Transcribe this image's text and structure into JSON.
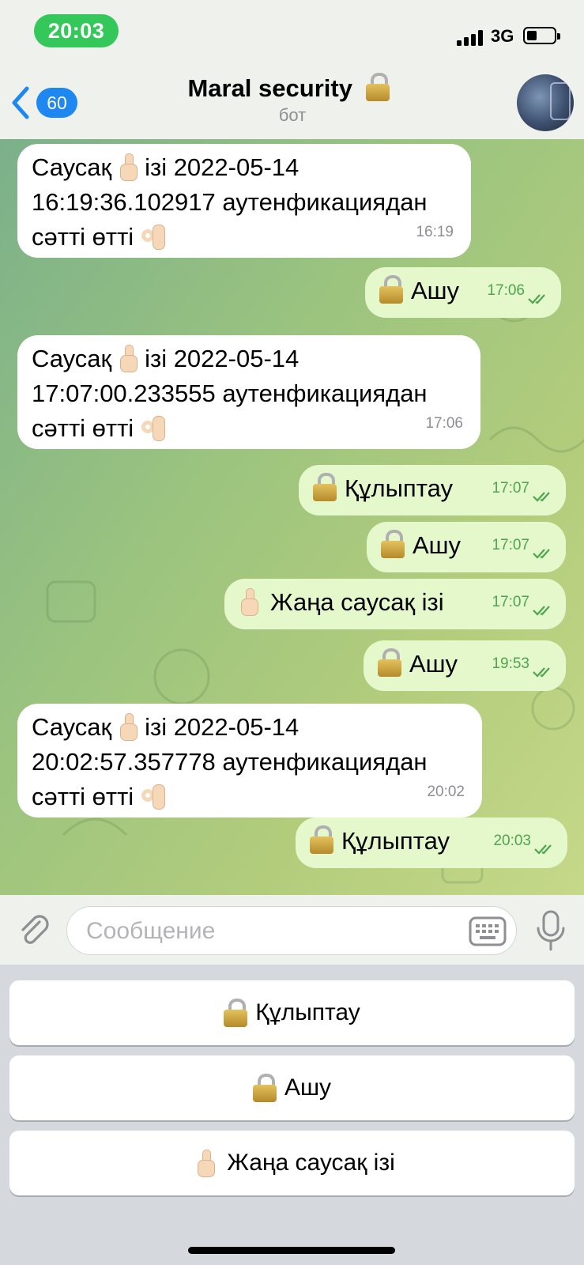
{
  "status_bar": {
    "time": "20:03",
    "network": "3G"
  },
  "header": {
    "back_count": "60",
    "title": "Maral security",
    "subtitle": "бот"
  },
  "messages": [
    {
      "dir": "in",
      "line1": "Саусақ",
      "line1b": "ізі 2022-05-14",
      "line2": "16:19:36.102917 аутенфикациядан",
      "line3": "сәтті өтті",
      "time": "16:19"
    },
    {
      "dir": "out",
      "text": "Ашу",
      "time": "17:06"
    },
    {
      "dir": "in",
      "line1": "Саусақ",
      "line1b": "ізі 2022-05-14",
      "line2": "17:07:00.233555 аутенфикациядан",
      "line3": "сәтті өтті",
      "time": "17:06"
    },
    {
      "dir": "out",
      "text": "Құлыптау",
      "time": "17:07"
    },
    {
      "dir": "out",
      "text": "Ашу",
      "time": "17:07"
    },
    {
      "dir": "out",
      "text": "Жаңа саусақ ізі",
      "time": "17:07"
    },
    {
      "dir": "out",
      "text": "Ашу",
      "time": "19:53"
    },
    {
      "dir": "in",
      "line1": "Саусақ",
      "line1b": "ізі 2022-05-14",
      "line2": "20:02:57.357778 аутенфикациядан",
      "line3": "сәтті өтті",
      "time": "20:02"
    },
    {
      "dir": "out",
      "text": "Құлыптау",
      "time": "20:03"
    }
  ],
  "input": {
    "placeholder": "Сообщение"
  },
  "keyboard": {
    "buttons": [
      {
        "label": "Құлыптау"
      },
      {
        "label": "Ашу"
      },
      {
        "label": "Жаңа саусақ ізі"
      }
    ]
  },
  "icons": {
    "lock": "lock-emoji",
    "hand": "pointing-up-emoji",
    "ok": "ok-hand-emoji"
  },
  "colors": {
    "time_pill": "#34c759",
    "badge": "#1e88f0",
    "outgoing_bubble": "#e5f8cc",
    "read_checks": "#4ea54e"
  }
}
